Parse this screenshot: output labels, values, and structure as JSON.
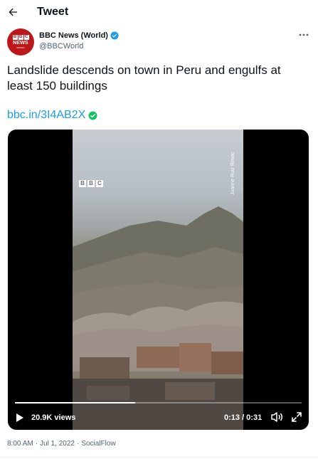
{
  "header": {
    "title": "Tweet",
    "back_icon": "arrow-left-icon"
  },
  "author": {
    "display_name": "BBC News (World)",
    "handle": "@BBCWorld",
    "verified": true,
    "avatar": {
      "letters": [
        "B",
        "B",
        "C"
      ],
      "line1": "NEWS",
      "line2": "WORLD"
    }
  },
  "tweet": {
    "text": "Landslide descends on town in Peru and engulfs at least 150 buildings",
    "link_text": "bbc.in/3I4AB2X"
  },
  "media": {
    "watermark_letters": [
      "B",
      "B",
      "C"
    ],
    "credit": "Joanne Ruiz Rimac",
    "views": "20.9K views",
    "time": "0:13 / 0:31",
    "progress": 0.42
  },
  "meta": {
    "time": "8:00 AM",
    "separator": "·",
    "date": "Jul 1, 2022",
    "source": "SocialFlow"
  },
  "colors": {
    "accent": "#1d9bf0",
    "bbc_red": "#bb1919",
    "verified": "#1d9bf0",
    "link_verified": "#17bf63"
  }
}
